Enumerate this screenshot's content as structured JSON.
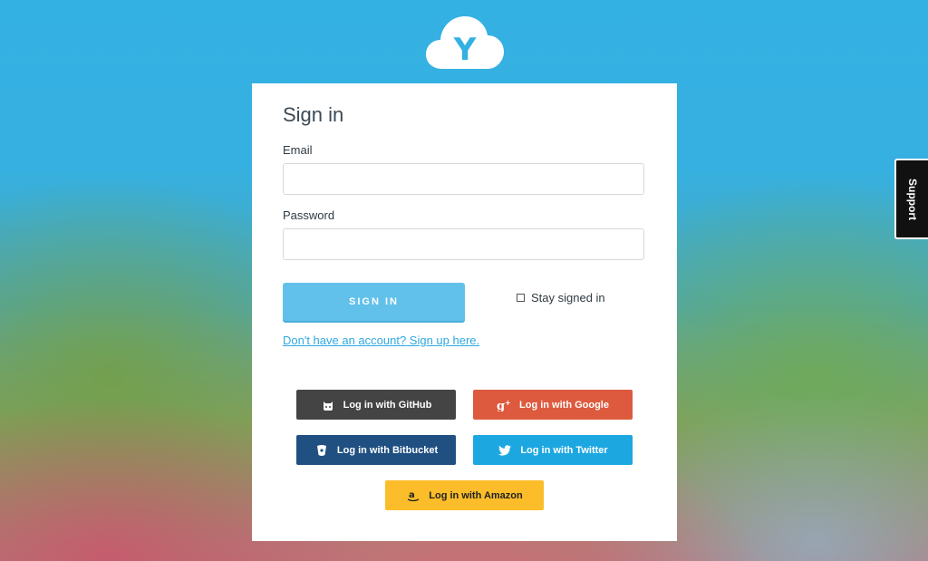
{
  "logo": {
    "letter": "Y"
  },
  "signin": {
    "title": "Sign in",
    "email_label": "Email",
    "email_value": "",
    "password_label": "Password",
    "password_value": "",
    "submit_label": "SIGN IN",
    "stay_signed_in_label": "Stay signed in",
    "stay_signed_in_checked": false,
    "signup_link": "Don't have an account? Sign up here."
  },
  "social": [
    {
      "label": "Log in with GitHub",
      "icon": "github-icon",
      "color": "#444444"
    },
    {
      "label": "Log in with Google",
      "icon": "google-plus-icon",
      "color": "#dd5a3e"
    },
    {
      "label": "Log in with Bitbucket",
      "icon": "bitbucket-icon",
      "color": "#205081"
    },
    {
      "label": "Log in with Twitter",
      "icon": "twitter-icon",
      "color": "#1da7e1"
    },
    {
      "label": "Log in with Amazon",
      "icon": "amazon-icon",
      "color": "#fbbd29"
    }
  ],
  "support": {
    "label": "Support"
  },
  "colors": {
    "accent": "#62c1ea",
    "link": "#2fa9e0",
    "background": "#34b1e3"
  }
}
